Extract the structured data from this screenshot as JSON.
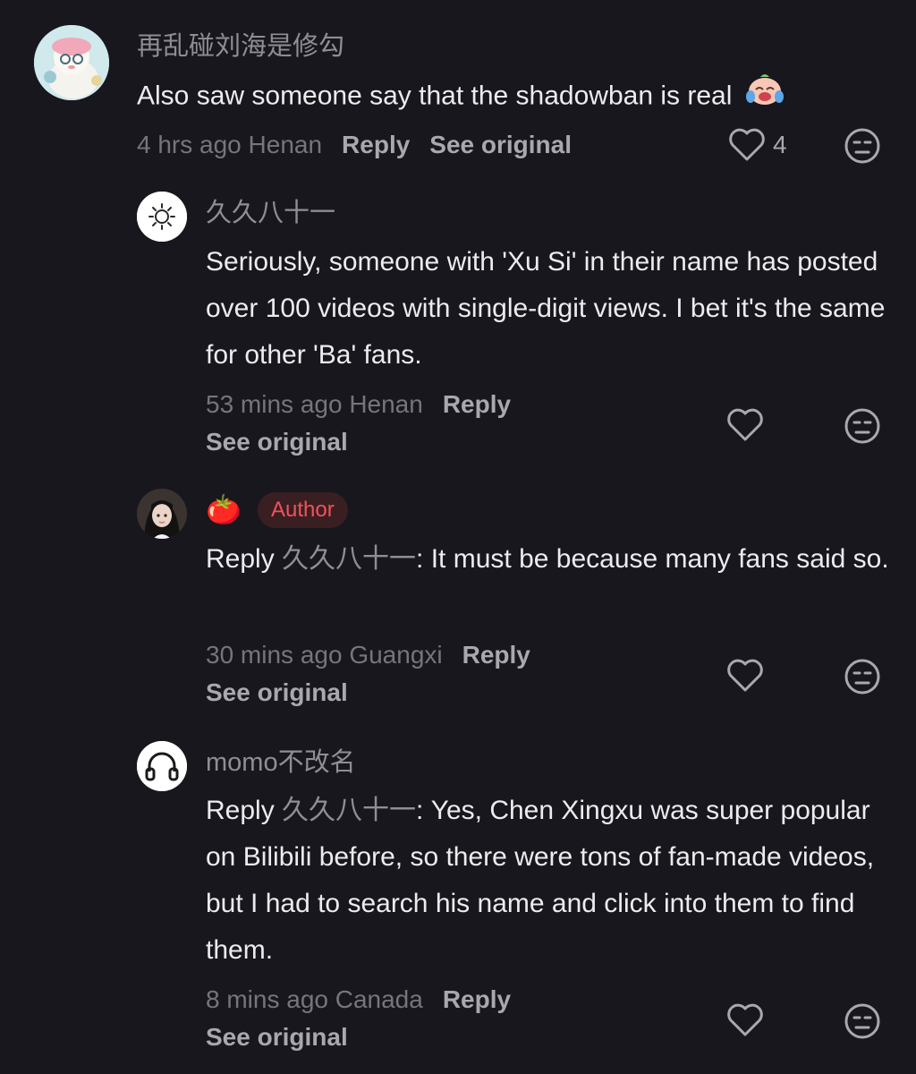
{
  "comments": [
    {
      "username": "再乱碰刘海是修勾",
      "text": "Also saw someone say that the shadowban is real",
      "time_location": "4 hrs ago Henan",
      "reply_label": "Reply",
      "see_original": "See original",
      "like_count": "4",
      "avatar": "cartoon-avatar-icon",
      "trailing_emoji": "crying-laughing-emoji-icon"
    },
    {
      "username": "久久八十一",
      "text": "Seriously, someone with 'Xu Si' in their name has posted over 100 videos with single-digit views. I bet it's the same for other 'Ba' fans.",
      "time_location": "53 mins ago Henan",
      "reply_label": "Reply",
      "see_original": "See original",
      "avatar": "sun-icon"
    },
    {
      "username": "🍅",
      "badge": "Author",
      "reply_prefix": "Reply",
      "reply_to": "久久八十一",
      "text": ": It must be because many fans said so.",
      "time_location": "30 mins ago Guangxi",
      "reply_label": "Reply",
      "see_original": "See original",
      "avatar": "girl-photo-avatar"
    },
    {
      "username": "momo不改名",
      "reply_prefix": "Reply",
      "reply_to": "久久八十一",
      "text": ": Yes, Chen Xingxu was super popular on Bilibili before, so there were tons of fan-made videos, but I had to search his name and click into them to find them.",
      "time_location": "8 mins ago Canada",
      "reply_label": "Reply",
      "see_original": "See original",
      "avatar": "headphones-icon"
    }
  ],
  "colors": {
    "background": "#18171d",
    "primary_text": "#ececef",
    "secondary_text": "#8f8e95",
    "author_badge_bg": "#3a1f22",
    "author_badge_text": "#f0525c"
  }
}
